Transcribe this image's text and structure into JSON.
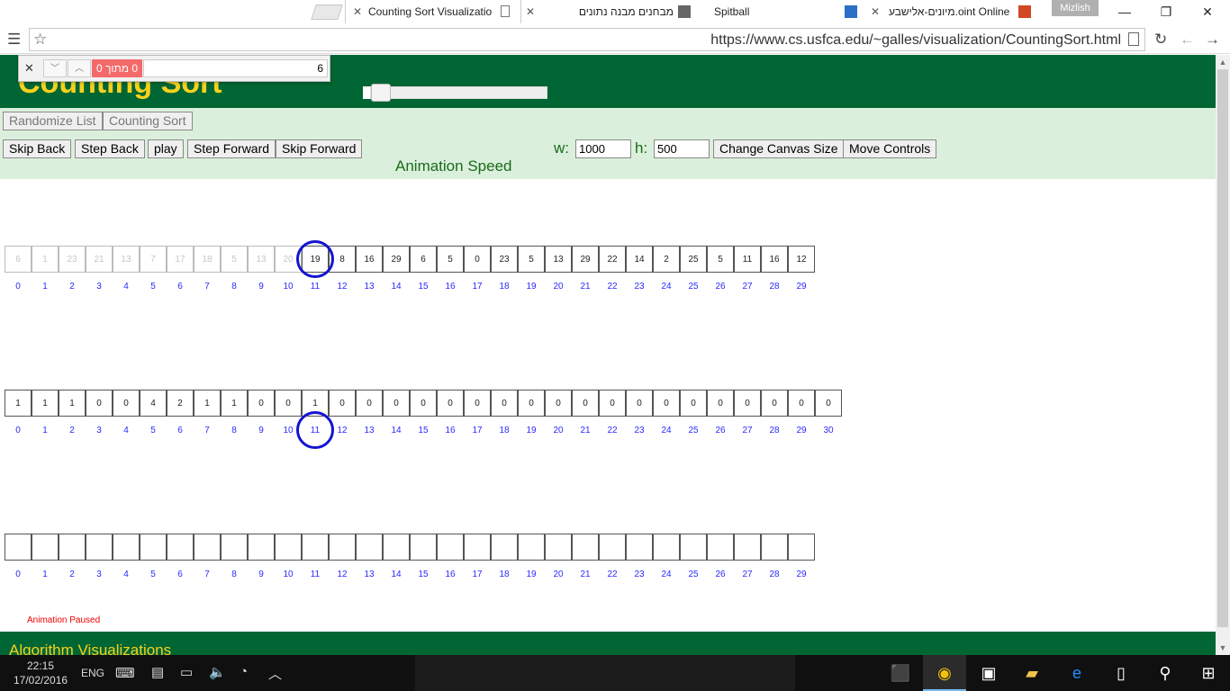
{
  "browser": {
    "tabs": [
      {
        "title": "Counting Sort Visualizatio",
        "active": true
      },
      {
        "title": "מבחנים מבנה נתונים",
        "active": false
      },
      {
        "title": "Spitball",
        "active": false
      },
      {
        "title": "מיונים-אלישבע.oint Online",
        "active": false
      }
    ],
    "profile": "Mizlish",
    "url": "https://www.cs.usfca.edu/~galles/visualization/CountingSort.html"
  },
  "findbar": {
    "count": "0 מתוך 0",
    "query": "6"
  },
  "page": {
    "title": "Counting Sort",
    "buttons": {
      "randomize": "Randomize List",
      "counting_sort": "Counting Sort",
      "skip_back": "Skip Back",
      "step_back": "Step Back",
      "play": "play",
      "step_forward": "Step Forward",
      "skip_forward": "Skip Forward",
      "change_canvas": "Change Canvas Size",
      "move_controls": "Move Controls"
    },
    "speed_label": "Animation Speed",
    "speed_level": 0.05,
    "w_label": "w:",
    "w_value": "1000",
    "h_label": "h:",
    "h_value": "500",
    "status": "Animation Paused",
    "footer": "Algorithm Visualizations"
  },
  "arrays": {
    "input": {
      "values": [
        "6",
        "1",
        "23",
        "21",
        "13",
        "7",
        "17",
        "18",
        "5",
        "13",
        "20",
        "19",
        "8",
        "16",
        "29",
        "6",
        "5",
        "0",
        "23",
        "5",
        "13",
        "29",
        "22",
        "14",
        "2",
        "25",
        "5",
        "11",
        "16",
        "12"
      ],
      "faded_count": 11,
      "indices": [
        "0",
        "1",
        "2",
        "3",
        "4",
        "5",
        "6",
        "7",
        "8",
        "9",
        "10",
        "11",
        "12",
        "13",
        "14",
        "15",
        "16",
        "17",
        "18",
        "19",
        "20",
        "21",
        "22",
        "23",
        "24",
        "25",
        "26",
        "27",
        "28",
        "29"
      ]
    },
    "counts": {
      "values": [
        "1",
        "1",
        "1",
        "0",
        "0",
        "4",
        "2",
        "1",
        "1",
        "0",
        "0",
        "1",
        "0",
        "0",
        "0",
        "0",
        "0",
        "0",
        "0",
        "0",
        "0",
        "0",
        "0",
        "0",
        "0",
        "0",
        "0",
        "0",
        "0",
        "0",
        "0"
      ],
      "indices": [
        "0",
        "1",
        "2",
        "3",
        "4",
        "5",
        "6",
        "7",
        "8",
        "9",
        "10",
        "11",
        "12",
        "13",
        "14",
        "15",
        "16",
        "17",
        "18",
        "19",
        "20",
        "21",
        "22",
        "23",
        "24",
        "25",
        "26",
        "27",
        "28",
        "29",
        "30"
      ]
    },
    "output": {
      "values": [
        "",
        "",
        "",
        "",
        "",
        "",
        "",
        "",
        "",
        "",
        "",
        "",
        "",
        "",
        "",
        "",
        "",
        "",
        "",
        "",
        "",
        "",
        "",
        "",
        "",
        "",
        "",
        "",
        "",
        ""
      ],
      "indices": [
        "0",
        "1",
        "2",
        "3",
        "4",
        "5",
        "6",
        "7",
        "8",
        "9",
        "10",
        "11",
        "12",
        "13",
        "14",
        "15",
        "16",
        "17",
        "18",
        "19",
        "20",
        "21",
        "22",
        "23",
        "24",
        "25",
        "26",
        "27",
        "28",
        "29"
      ]
    },
    "highlight_index": 11
  },
  "taskbar": {
    "time": "22:15",
    "date": "17/02/2016",
    "lang": "ENG"
  }
}
